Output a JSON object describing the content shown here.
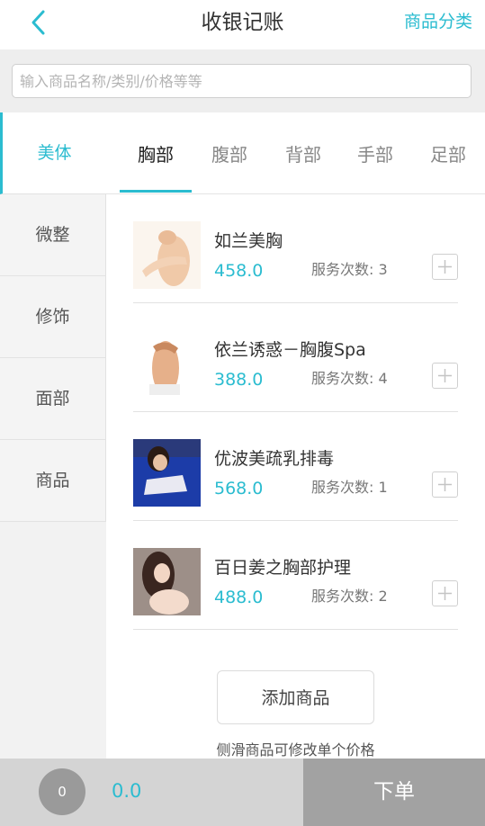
{
  "header": {
    "title": "收银记账",
    "action_label": "商品分类",
    "back_icon": "chevron-left-icon",
    "accent_color": "#2bbcd0"
  },
  "search": {
    "placeholder": "输入商品名称/类别/价格等等",
    "value": ""
  },
  "sidebar": {
    "items": [
      {
        "label": "美体",
        "active": true
      },
      {
        "label": "微整",
        "active": false
      },
      {
        "label": "修饰",
        "active": false
      },
      {
        "label": "面部",
        "active": false
      },
      {
        "label": "商品",
        "active": false
      }
    ]
  },
  "tabs": [
    {
      "label": "胸部",
      "active": true
    },
    {
      "label": "腹部",
      "active": false
    },
    {
      "label": "背部",
      "active": false
    },
    {
      "label": "手部",
      "active": false
    },
    {
      "label": "足部",
      "active": false
    }
  ],
  "products": [
    {
      "name": "如兰美胸",
      "price": "458.0",
      "count_text": "服务次数: 3"
    },
    {
      "name": "依兰诱惑－胸腹Spa",
      "price": "388.0",
      "count_text": "服务次数: 4"
    },
    {
      "name": "优波美疏乳排毒",
      "price": "568.0",
      "count_text": "服务次数: 1"
    },
    {
      "name": "百日姜之胸部护理",
      "price": "488.0",
      "count_text": "服务次数: 2"
    }
  ],
  "add_product_label": "添加商品",
  "hint": "侧滑商品可修改单个价格",
  "footer": {
    "cart_count": "0",
    "total": "0.0",
    "order_label": "下单"
  }
}
